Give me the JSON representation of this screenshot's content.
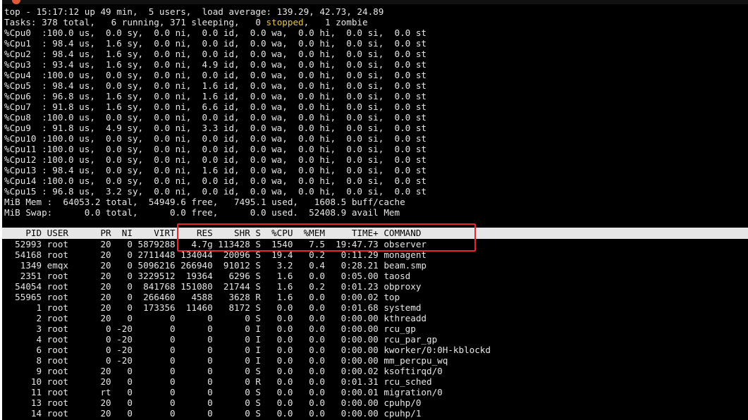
{
  "summary": {
    "line1": "top - 15:17:12 up 49 min,  5 users,  load average: 139.29, 42.73, 24.89",
    "tasks_before": "Tasks: 378 total,   6 running, 371 sleeping,   0 ",
    "tasks_stopped": "stopped",
    "tasks_after": ",   1 zombie"
  },
  "cpus": [
    "%Cpu0  :100.0 us,  0.0 sy,  0.0 ni,  0.0 id,  0.0 wa,  0.0 hi,  0.0 si,  0.0 st",
    "%Cpu1  : 98.4 us,  1.6 sy,  0.0 ni,  0.0 id,  0.0 wa,  0.0 hi,  0.0 si,  0.0 st",
    "%Cpu2  : 98.4 us,  1.6 sy,  0.0 ni,  0.0 id,  0.0 wa,  0.0 hi,  0.0 si,  0.0 st",
    "%Cpu3  : 93.4 us,  1.6 sy,  0.0 ni,  4.9 id,  0.0 wa,  0.0 hi,  0.0 si,  0.0 st",
    "%Cpu4  :100.0 us,  0.0 sy,  0.0 ni,  0.0 id,  0.0 wa,  0.0 hi,  0.0 si,  0.0 st",
    "%Cpu5  : 98.4 us,  0.0 sy,  0.0 ni,  1.6 id,  0.0 wa,  0.0 hi,  0.0 si,  0.0 st",
    "%Cpu6  : 96.8 us,  1.6 sy,  0.0 ni,  1.6 id,  0.0 wa,  0.0 hi,  0.0 si,  0.0 st",
    "%Cpu7  : 91.8 us,  1.6 sy,  0.0 ni,  6.6 id,  0.0 wa,  0.0 hi,  0.0 si,  0.0 st",
    "%Cpu8  :100.0 us,  0.0 sy,  0.0 ni,  0.0 id,  0.0 wa,  0.0 hi,  0.0 si,  0.0 st",
    "%Cpu9  : 91.8 us,  4.9 sy,  0.0 ni,  3.3 id,  0.0 wa,  0.0 hi,  0.0 si,  0.0 st",
    "%Cpu10 :100.0 us,  0.0 sy,  0.0 ni,  0.0 id,  0.0 wa,  0.0 hi,  0.0 si,  0.0 st",
    "%Cpu11 :100.0 us,  0.0 sy,  0.0 ni,  0.0 id,  0.0 wa,  0.0 hi,  0.0 si,  0.0 st",
    "%Cpu12 :100.0 us,  0.0 sy,  0.0 ni,  0.0 id,  0.0 wa,  0.0 hi,  0.0 si,  0.0 st",
    "%Cpu13 : 98.4 us,  0.0 sy,  0.0 ni,  1.6 id,  0.0 wa,  0.0 hi,  0.0 si,  0.0 st",
    "%Cpu14 :100.0 us,  0.0 sy,  0.0 ni,  0.0 id,  0.0 wa,  0.0 hi,  0.0 si,  0.0 st",
    "%Cpu15 : 96.8 us,  3.2 sy,  0.0 ni,  0.0 id,  0.0 wa,  0.0 hi,  0.0 si,  0.0 st"
  ],
  "memory": {
    "mem": "MiB Mem :  64053.2 total,  54949.6 free,   7495.1 used,   1608.5 buff/cache",
    "swap": "MiB Swap:      0.0 total,      0.0 free,      0.0 used.  52408.9 avail Mem"
  },
  "table": {
    "header": "    PID USER      PR  NI    VIRT    RES    SHR S  %CPU  %MEM     TIME+ COMMAND",
    "rows": [
      "  52993 root      20   0 5879288   4.7g 113428 S  1540   7.5  19:47.73 observer",
      "  54168 root      20   0 2711448 134044  20096 S  19.4   0.2   0:11.29 monagent",
      "   1349 emqx      20   0 5096216 266940  91012 S   3.2   0.4   0:28.21 beam.smp",
      "   2351 root      20   0 3229512  19364   6296 S   1.6   0.0   0:05.00 taosd",
      "  54054 root      20   0  841768 151080  21744 S   1.6   0.2   0:01.23 obproxy",
      "  55965 root      20   0  266460   4588   3628 R   1.6   0.0   0:00.02 top",
      "      1 root      20   0  173356  11460   8172 S   0.0   0.0   0:01.68 systemd",
      "      2 root      20   0       0      0      0 S   0.0   0.0   0:00.00 kthreadd",
      "      3 root       0 -20       0      0      0 I   0.0   0.0   0:00.00 rcu_gp",
      "      4 root       0 -20       0      0      0 I   0.0   0.0   0:00.00 rcu_par_gp",
      "      6 root       0 -20       0      0      0 I   0.0   0.0   0:00.00 kworker/0:0H-kblockd",
      "      8 root       0 -20       0      0      0 I   0.0   0.0   0:00.00 mm_percpu_wq",
      "      9 root      20   0       0      0      0 S   0.0   0.0   0:00.02 ksoftirqd/0",
      "     10 root      20   0       0      0      0 R   0.0   0.0   0:01.31 rcu_sched",
      "     11 root      rt   0       0      0      0 S   0.0   0.0   0:00.01 migration/0",
      "     13 root      20   0       0      0      0 S   0.0   0.0   0:00.00 cpuhp/0",
      "     14 root      20   0       0      0      0 S   0.0   0.0   0:00.00 cpuhp/1"
    ]
  },
  "colors": {
    "background": "#000000",
    "text": "#e6e6e6",
    "stopped_highlight": "#e8c53a",
    "annotation_box": "#e8262b"
  }
}
